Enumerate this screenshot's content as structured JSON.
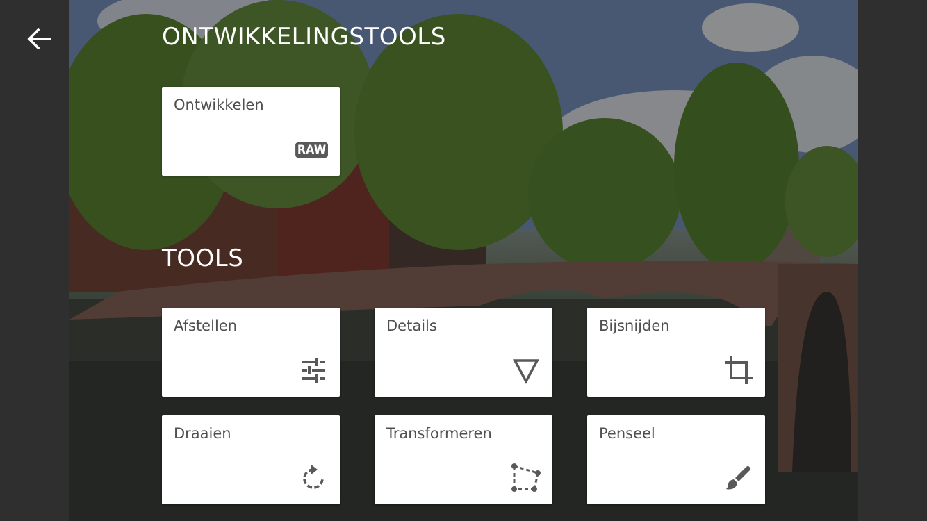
{
  "header": {
    "back_icon": "arrow-left-icon"
  },
  "sections": {
    "development_title": "ONTWIKKELINGSTOOLS",
    "tools_title": "TOOLS"
  },
  "dev_tools": [
    {
      "label": "Ontwikkelen",
      "badge": "RAW"
    }
  ],
  "tools": [
    {
      "label": "Afstellen",
      "icon": "sliders-icon"
    },
    {
      "label": "Details",
      "icon": "triangle-down-icon"
    },
    {
      "label": "Bijsnijden",
      "icon": "crop-icon"
    },
    {
      "label": "Draaien",
      "icon": "rotate-icon"
    },
    {
      "label": "Transformeren",
      "icon": "transform-icon"
    },
    {
      "label": "Penseel",
      "icon": "brush-icon"
    }
  ],
  "colors": {
    "sidebar": "#2f2f2f",
    "card": "#ffffff",
    "card_text": "#505050",
    "icon": "#595959"
  }
}
